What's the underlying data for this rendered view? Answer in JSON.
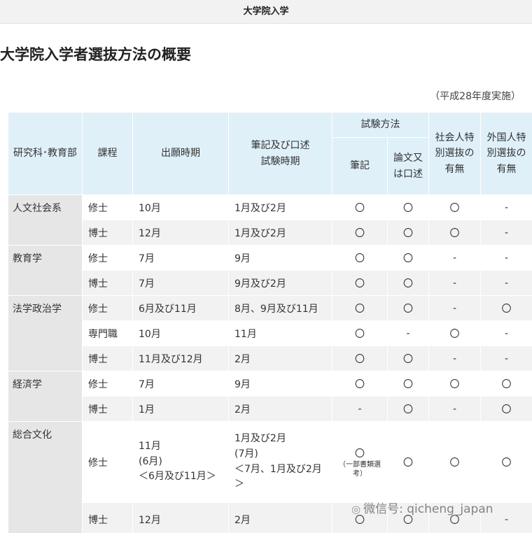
{
  "top_bar": {
    "title": "大学院入学"
  },
  "page_title": "大学院入学者選抜方法の概要",
  "note": "（平成28年度実施）",
  "headers": {
    "department": "研究科･教育部",
    "course": "課程",
    "application": "出願時期",
    "exam_period": "筆記及び口述試験時期",
    "exam_method": "試験方法",
    "written": "筆記",
    "thesis_oral": "論文又は口述",
    "working_adult": "社会人特別選抜の有無",
    "foreign_student": "外国人特別選抜の有無"
  },
  "groups": [
    {
      "department": "人文社会系",
      "rows": [
        {
          "course": "修士",
          "application": "10月",
          "exam": "1月及び2月",
          "written": "〇",
          "thesis": "〇",
          "working": "〇",
          "foreign": "-"
        },
        {
          "course": "博士",
          "application": "12月",
          "exam": "1月及び2月",
          "written": "〇",
          "thesis": "〇",
          "working": "〇",
          "foreign": "-"
        }
      ]
    },
    {
      "department": "教育学",
      "rows": [
        {
          "course": "修士",
          "application": "7月",
          "exam": "9月",
          "written": "〇",
          "thesis": "〇",
          "working": "-",
          "foreign": "-"
        },
        {
          "course": "博士",
          "application": "7月",
          "exam": "9月及び2月",
          "written": "〇",
          "thesis": "〇",
          "working": "-",
          "foreign": "-"
        }
      ]
    },
    {
      "department": "法学政治学",
      "rows": [
        {
          "course": "修士",
          "application": "6月及び11月",
          "exam": "8月、9月及び11月",
          "written": "〇",
          "thesis": "〇",
          "working": "-",
          "foreign": "〇"
        },
        {
          "course": "専門職",
          "application": "10月",
          "exam": "11月",
          "written": "〇",
          "thesis": "-",
          "working": "〇",
          "foreign": "-"
        },
        {
          "course": "博士",
          "application": "11月及び12月",
          "exam": "2月",
          "written": "〇",
          "thesis": "〇",
          "working": "-",
          "foreign": "-"
        }
      ]
    },
    {
      "department": "経済学",
      "rows": [
        {
          "course": "修士",
          "application": "7月",
          "exam": "9月",
          "written": "〇",
          "thesis": "〇",
          "working": "〇",
          "foreign": "〇"
        },
        {
          "course": "博士",
          "application": "1月",
          "exam": "2月",
          "written": "-",
          "thesis": "〇",
          "working": "-",
          "foreign": "〇"
        }
      ]
    },
    {
      "department": "総合文化",
      "rows": [
        {
          "course": "修士",
          "application_lines": [
            "11月",
            "(6月)",
            "＜6月及び11月＞"
          ],
          "exam_lines": [
            "1月及び2月",
            "(7月)",
            "＜7月、1月及び2月",
            "＞"
          ],
          "written": "〇",
          "written_note": "（一部書類選考）",
          "thesis": "〇",
          "working": "〇",
          "foreign": "〇"
        },
        {
          "course": "博士",
          "application": "12月",
          "exam": "2月",
          "written": "〇",
          "thesis": "〇",
          "working": "〇",
          "foreign": "-"
        }
      ]
    }
  ],
  "watermark": "微信号: qicheng_japan"
}
